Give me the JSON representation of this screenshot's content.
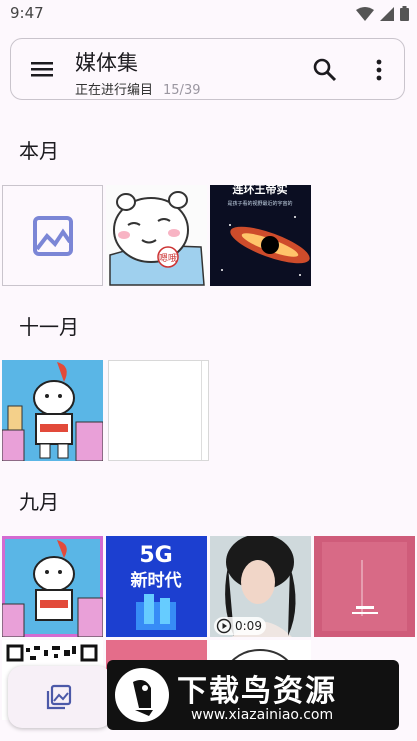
{
  "status_bar": {
    "time": "9:47"
  },
  "app_bar": {
    "title": "媒体集",
    "subtitle": "正在进行编目",
    "progress_count": "15/39",
    "icons": [
      "menu-icon",
      "search-icon",
      "more-vert-icon"
    ]
  },
  "sections": [
    {
      "title": "本月"
    },
    {
      "title": "十一月"
    },
    {
      "title": "九月"
    }
  ],
  "thumbnails": {
    "month_1": {
      "bear_badge": "嗯哦",
      "space_banner": "连环王帝实",
      "space_caption": "是孩子看的视野最近的宇宙的"
    },
    "sep_2": {
      "banner_top": "5G",
      "banner_bottom": "新时代"
    },
    "sep_3": {
      "video_duration": "0:09"
    }
  },
  "watermark": {
    "title": "下载鸟资源",
    "url": "www.xiazainiao.com"
  },
  "colors": {
    "accent": "#7b86d6",
    "background": "#fdf8fd",
    "outline": "#c9c4cc"
  }
}
